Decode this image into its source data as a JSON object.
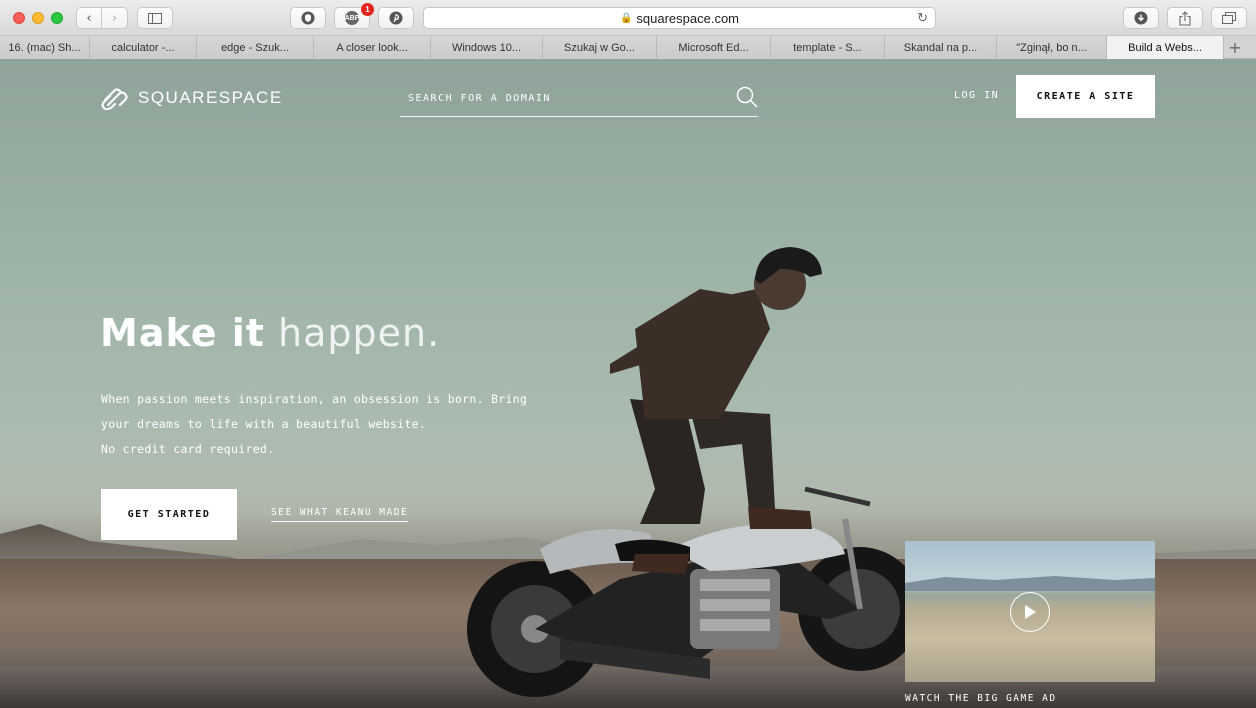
{
  "browser": {
    "url": "squarespace.com",
    "extension_badge_count": "1",
    "extension_abp_label": "ABP",
    "tabs": [
      {
        "label": "16. (mac) Sh..."
      },
      {
        "label": "calculator -..."
      },
      {
        "label": "edge - Szuk..."
      },
      {
        "label": "A closer look..."
      },
      {
        "label": "Windows 10..."
      },
      {
        "label": "Szukaj w Go..."
      },
      {
        "label": "Microsoft Ed..."
      },
      {
        "label": "template - S..."
      },
      {
        "label": "Skandal na p..."
      },
      {
        "label": "\"Zginął, bo n..."
      },
      {
        "label": "Build a Webs..."
      }
    ],
    "active_tab_index": 10
  },
  "header": {
    "logo_text": "SQUARESPACE",
    "search_placeholder": "SEARCH FOR A DOMAIN",
    "login_label": "LOG IN",
    "create_site_label": "CREATE A SITE"
  },
  "hero": {
    "headline_part1": "Make it",
    "headline_part2": "happen.",
    "description_lines": [
      "When passion meets inspiration, an obsession is born. Bring",
      "your dreams to life with a beautiful website.",
      "No credit card required."
    ],
    "get_started_label": "GET STARTED",
    "keanu_link_label": "SEE WHAT KEANU MADE",
    "video_caption": "WATCH THE BIG GAME AD"
  },
  "colors": {
    "accent": "#ffffff",
    "close": "#fc5f57",
    "minimize": "#fdbc2e",
    "maximize": "#28c840"
  }
}
